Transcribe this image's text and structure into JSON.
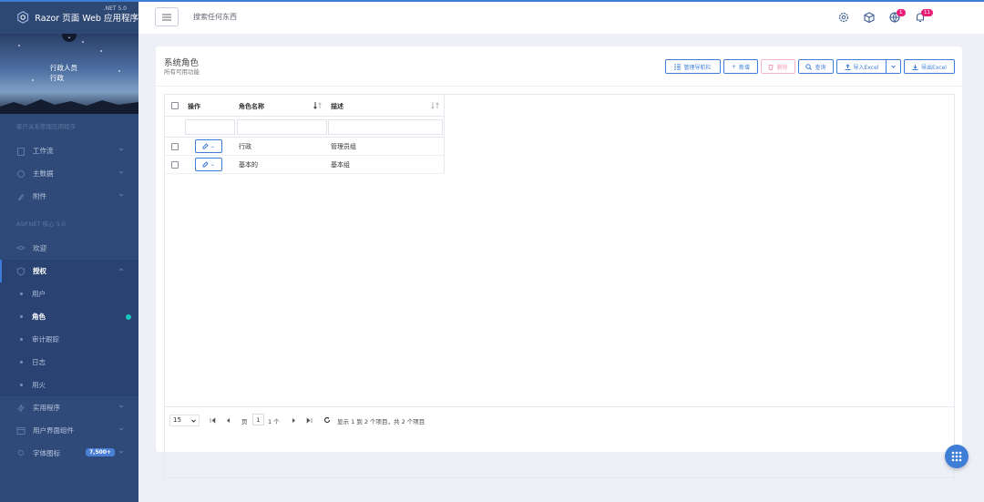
{
  "app": {
    "brand": "Razor 页面 Web 应用程序",
    "brand_version": ".NET 5.0"
  },
  "user": {
    "name": "行政人员",
    "role": "行政"
  },
  "sidebar": {
    "section1": "客户关系管理应用程序",
    "items1": [
      {
        "label": "工作流"
      },
      {
        "label": "主数据"
      },
      {
        "label": "附件"
      }
    ],
    "section2": "ASP.NET 核心 5.0",
    "items2": [
      {
        "label": "欢迎"
      },
      {
        "label": "授权"
      }
    ],
    "sub": [
      {
        "label": "用户"
      },
      {
        "label": "角色"
      },
      {
        "label": "审计跟踪"
      },
      {
        "label": "日志"
      },
      {
        "label": "用火"
      }
    ],
    "items3": [
      {
        "label": "实用程序"
      },
      {
        "label": "用户界面组件"
      },
      {
        "label": "字体图标",
        "badge": "7,500+"
      }
    ]
  },
  "header": {
    "search_placeholder": "搜索任何东西",
    "badge_globe": "1",
    "badge_bell": "11"
  },
  "card": {
    "title": "系统角色",
    "subtitle": "所有可用功能"
  },
  "toolbar": {
    "nav": "管理导航栏",
    "add": "新增",
    "delete": "删除",
    "search": "查询",
    "import": "导入Excel",
    "export": "导出Excel"
  },
  "table": {
    "headers": {
      "action": "操作",
      "name": "角色名称",
      "desc": "描述"
    },
    "rows": [
      {
        "name": "行政",
        "desc": "管理员组"
      },
      {
        "name": "基本的",
        "desc": "基本组"
      }
    ]
  },
  "pager": {
    "page_size": "15",
    "page_label": "页",
    "page_num": "1",
    "of_label": "1 个",
    "info": "显示 1 到 2 个项目，共 2 个项目"
  },
  "colors": {
    "accent": "#3f7ed7",
    "sidebar": "#2f4a78",
    "pink": "#e91e76"
  }
}
